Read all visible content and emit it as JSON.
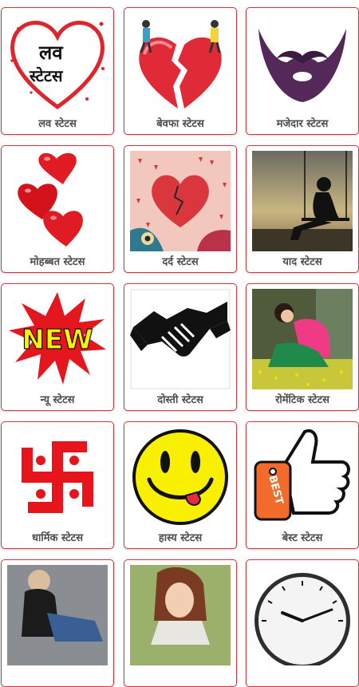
{
  "grid": {
    "items": [
      {
        "label": "लव स्टेटस",
        "icon": "love-status-heart-icon"
      },
      {
        "label": "बेवफा स्टेटस",
        "icon": "broken-heart-icon"
      },
      {
        "label": "मजेदार स्टेटस",
        "icon": "mustache-beard-icon"
      },
      {
        "label": "मोहब्बत स्टेटस",
        "icon": "red-heart-balloons-icon"
      },
      {
        "label": "दर्द स्टेटस",
        "icon": "pain-heart-art-icon"
      },
      {
        "label": "याद स्टेटस",
        "icon": "swing-silhouette-icon"
      },
      {
        "label": "न्यू स्टेटस",
        "icon": "new-starburst-icon"
      },
      {
        "label": "दोस्ती स्टेटस",
        "icon": "handshake-icon"
      },
      {
        "label": "रोमेंटिक स्टेटस",
        "icon": "girl-in-field-photo"
      },
      {
        "label": "धार्मिक स्टेटस",
        "icon": "swastika-icon"
      },
      {
        "label": "हास्य स्टेटस",
        "icon": "smiley-face-icon"
      },
      {
        "label": "बेस्ट स्टेटस",
        "icon": "best-thumbs-up-icon"
      },
      {
        "label": "",
        "icon": "sad-person-photo"
      },
      {
        "label": "",
        "icon": "sad-girl-photo"
      },
      {
        "label": "",
        "icon": "wall-clock-icon"
      }
    ],
    "love_text_line1": "लव",
    "love_text_line2": "स्टेटस",
    "new_text": "NEW",
    "best_text": "BEST"
  },
  "colors": {
    "card_border": "#d7333c",
    "label_text": "#4d4d4d"
  }
}
